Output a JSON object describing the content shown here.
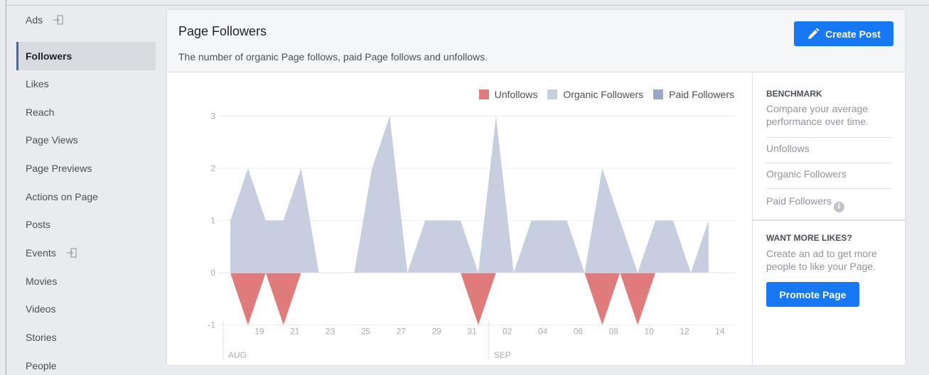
{
  "sidebar": {
    "items": [
      {
        "label": "Ads",
        "external": true
      },
      {
        "label": "Followers",
        "active": true
      },
      {
        "label": "Likes"
      },
      {
        "label": "Reach"
      },
      {
        "label": "Page Views"
      },
      {
        "label": "Page Previews"
      },
      {
        "label": "Actions on Page"
      },
      {
        "label": "Posts"
      },
      {
        "label": "Events",
        "external": true
      },
      {
        "label": "Movies"
      },
      {
        "label": "Videos"
      },
      {
        "label": "Stories"
      },
      {
        "label": "People"
      }
    ]
  },
  "header": {
    "title": "Page Followers",
    "subtitle": "The number of organic Page follows, paid Page follows and unfollows.",
    "create_post_label": "Create Post"
  },
  "benchmark": {
    "heading": "BENCHMARK",
    "description": "Compare your average performance over time.",
    "items": [
      "Unfollows",
      "Organic Followers",
      "Paid Followers"
    ]
  },
  "promo": {
    "heading": "WANT MORE LIKES?",
    "description": "Create an ad to get more people to like your Page.",
    "button_label": "Promote Page"
  },
  "colors": {
    "accent": "#1877f2",
    "unfollows": "#e07b7b",
    "organic": "#c6cee0",
    "paid": "#9aa7c7"
  },
  "chart_data": {
    "type": "area",
    "legend": [
      "Unfollows",
      "Organic Followers",
      "Paid Followers"
    ],
    "legend_position": "top-right",
    "ylim": [
      -1,
      3
    ],
    "yticks": [
      -1,
      0,
      1,
      2,
      3
    ],
    "x": [
      "Aug 18",
      "Aug 19",
      "Aug 20",
      "Aug 21",
      "Aug 22",
      "Aug 23",
      "Aug 24",
      "Aug 25",
      "Aug 26",
      "Aug 27",
      "Aug 28",
      "Aug 29",
      "Aug 30",
      "Aug 31",
      "Sep 01",
      "Sep 02",
      "Sep 03",
      "Sep 04",
      "Sep 05",
      "Sep 06",
      "Sep 07",
      "Sep 08",
      "Sep 09",
      "Sep 10",
      "Sep 11",
      "Sep 12",
      "Sep 13",
      "Sep 14"
    ],
    "xtick_labels": [
      "19",
      "21",
      "23",
      "25",
      "27",
      "29",
      "31",
      "02",
      "04",
      "06",
      "08",
      "10",
      "12",
      "14"
    ],
    "xtick_indices": [
      1,
      3,
      5,
      7,
      9,
      11,
      13,
      15,
      17,
      19,
      21,
      23,
      25,
      27
    ],
    "month_labels": [
      {
        "label": "AUG",
        "index": 0
      },
      {
        "label": "SEP",
        "index": 15
      }
    ],
    "series": [
      {
        "name": "Organic Followers",
        "values": [
          1,
          2,
          1,
          1,
          2,
          0,
          0,
          0,
          2,
          3,
          0,
          1,
          1,
          1,
          0,
          3,
          0,
          1,
          1,
          1,
          0,
          2,
          1,
          0,
          1,
          1,
          0,
          1
        ]
      },
      {
        "name": "Unfollows",
        "values": [
          0,
          -1,
          0,
          -1,
          0,
          0,
          0,
          0,
          0,
          0,
          0,
          0,
          0,
          0,
          -1,
          0,
          0,
          0,
          0,
          0,
          0,
          -1,
          0,
          -1,
          0,
          0,
          0,
          0
        ]
      },
      {
        "name": "Paid Followers",
        "values": [
          0,
          0,
          0,
          0,
          0,
          0,
          0,
          0,
          0,
          0,
          0,
          0,
          0,
          0,
          0,
          0,
          0,
          0,
          0,
          0,
          0,
          0,
          0,
          0,
          0,
          0,
          0,
          0
        ]
      }
    ],
    "grid": true
  }
}
